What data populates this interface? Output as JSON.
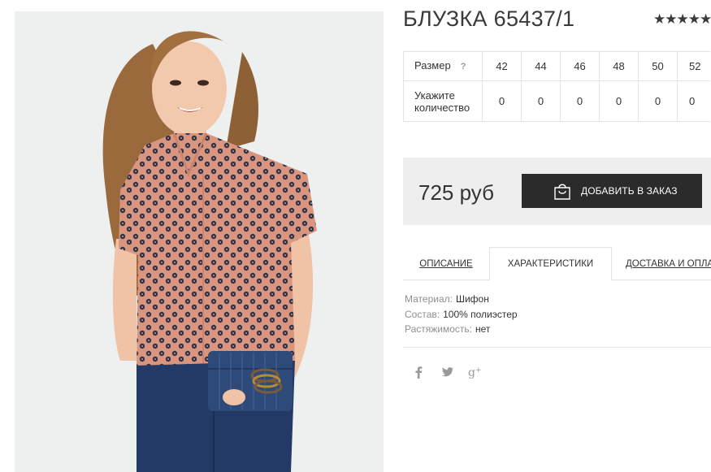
{
  "product": {
    "title": "БЛУЗКА 65437/1",
    "rating_stars": "★★★★★"
  },
  "sizes": {
    "size_label": "Размер",
    "hint_symbol": "?",
    "quantity_label_line1": "Укажите",
    "quantity_label_line2": "количество",
    "values": [
      "42",
      "44",
      "46",
      "48",
      "50",
      "52"
    ],
    "quantities": [
      "0",
      "0",
      "0",
      "0",
      "0",
      "0"
    ]
  },
  "order": {
    "price": "725 руб",
    "add_button_label": "ДОБАВИТЬ В ЗАКАЗ"
  },
  "tabs": {
    "description": "ОПИСАНИЕ",
    "characteristics": "ХАРАКТЕРИСТИКИ",
    "delivery": "ДОСТАВКА И ОПЛАТА"
  },
  "specs": [
    {
      "key": "Материал:",
      "value": "Шифон"
    },
    {
      "key": "Состав:",
      "value": "100% полиэстер"
    },
    {
      "key": "Растяжимость:",
      "value": "нет"
    }
  ],
  "social": {
    "facebook": "f",
    "twitter": "🐦",
    "google": "g+"
  },
  "colors": {
    "dark_button": "#2b2b2b",
    "order_box_bg": "#eeeeee",
    "border": "#e3e3e3",
    "muted_text": "#8f8f8f"
  }
}
